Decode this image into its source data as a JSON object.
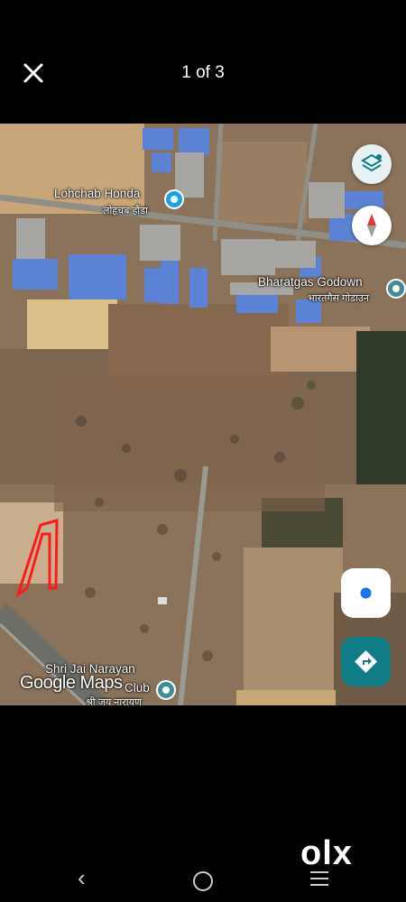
{
  "viewer": {
    "close_icon": "close-icon",
    "counter": "1 of 3"
  },
  "map": {
    "places": [
      {
        "name": "Lohchab Honda",
        "native": "लोहचब हौंडा",
        "icon": "shopping-bag-pin-icon",
        "color": "#1aa3e8"
      },
      {
        "name": "Bharatgas Godown",
        "native": "भारतगैस गोडाउन",
        "icon": "place-pin-icon",
        "color": "#3e8e99"
      },
      {
        "name": "Shri Jai Narayan",
        "native": "श्री जय नारायण",
        "suffix": "Club",
        "icon": "place-pin-icon",
        "color": "#3e8e99"
      }
    ],
    "watermark": "Google Maps",
    "buttons": {
      "layers": "layers-icon",
      "compass": "compass-icon",
      "my_location": "my-location-icon",
      "directions": "directions-icon"
    },
    "colors": {
      "directions_bg": "#0f7c86",
      "location_dot": "#1a73e8",
      "plot_outline": "#ff1a1a"
    }
  },
  "branding": {
    "logo": "olx"
  },
  "navbar": {
    "back": "‹",
    "home": "home-icon",
    "recents": "recents-icon"
  }
}
